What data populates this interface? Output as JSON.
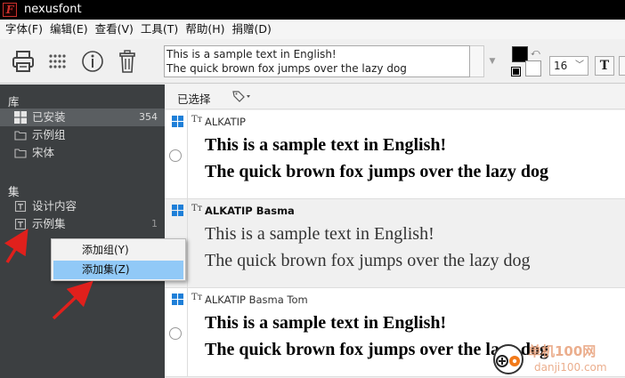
{
  "window": {
    "title": "nexusfont",
    "icon_letter": "F"
  },
  "menu": [
    "字体(F)",
    "编辑(E)",
    "查看(V)",
    "工具(T)",
    "帮助(H)",
    "捐赠(D)"
  ],
  "toolbar": {
    "icons": [
      "printer-icon",
      "grid-icon",
      "info-icon",
      "trash-icon"
    ],
    "sample_line1": "This is a sample text in English!",
    "sample_line2": "The quick brown fox jumps over the lazy dog",
    "font_size": "16",
    "text_style_button": "T",
    "fg_color": "#000000",
    "bg_color": "#ffffff"
  },
  "sidebar": {
    "library_header": "库",
    "library_items": [
      {
        "label": "已安装",
        "count": "354",
        "icon": "windows-icon",
        "selected": true
      },
      {
        "label": "示例组",
        "count": "",
        "icon": "folder-icon",
        "selected": false
      },
      {
        "label": "宋体",
        "count": "",
        "icon": "folder-icon",
        "selected": false
      }
    ],
    "collection_header": "集",
    "collection_items": [
      {
        "label": "设计内容",
        "count": "",
        "icon": "collection-icon"
      },
      {
        "label": "示例集",
        "count": "1",
        "icon": "collection-icon"
      }
    ]
  },
  "context_menu": {
    "items": [
      {
        "label": "添加组(Y)",
        "highlighted": false
      },
      {
        "label": "添加集(Z)",
        "highlighted": true
      }
    ]
  },
  "list_toolbar": {
    "selected_label": "已选择",
    "tag_icon": "tag-icon"
  },
  "fonts": [
    {
      "name": "ALKATIP",
      "line1": "This is a sample text in English!",
      "line2": "The quick brown fox jumps over the lazy dog",
      "bold_name": false,
      "selected": false
    },
    {
      "name": "ALKATIP Basma",
      "line1": "This is a sample text in English!",
      "line2": "The quick brown fox jumps over the lazy dog",
      "bold_name": true,
      "selected": true
    },
    {
      "name": "ALKATIP Basma Tom",
      "line1": "This is a sample text in English!",
      "line2": "The quick brown fox jumps over the lazy dog",
      "bold_name": false,
      "selected": false
    }
  ],
  "watermark": {
    "line1": "单机100网",
    "line2": "danji100.com"
  },
  "colors": {
    "sidebar_bg": "#3c3f41",
    "highlight": "#91c9f7",
    "arrow": "#e0201c",
    "windows_blue": "#1e7fd8"
  }
}
